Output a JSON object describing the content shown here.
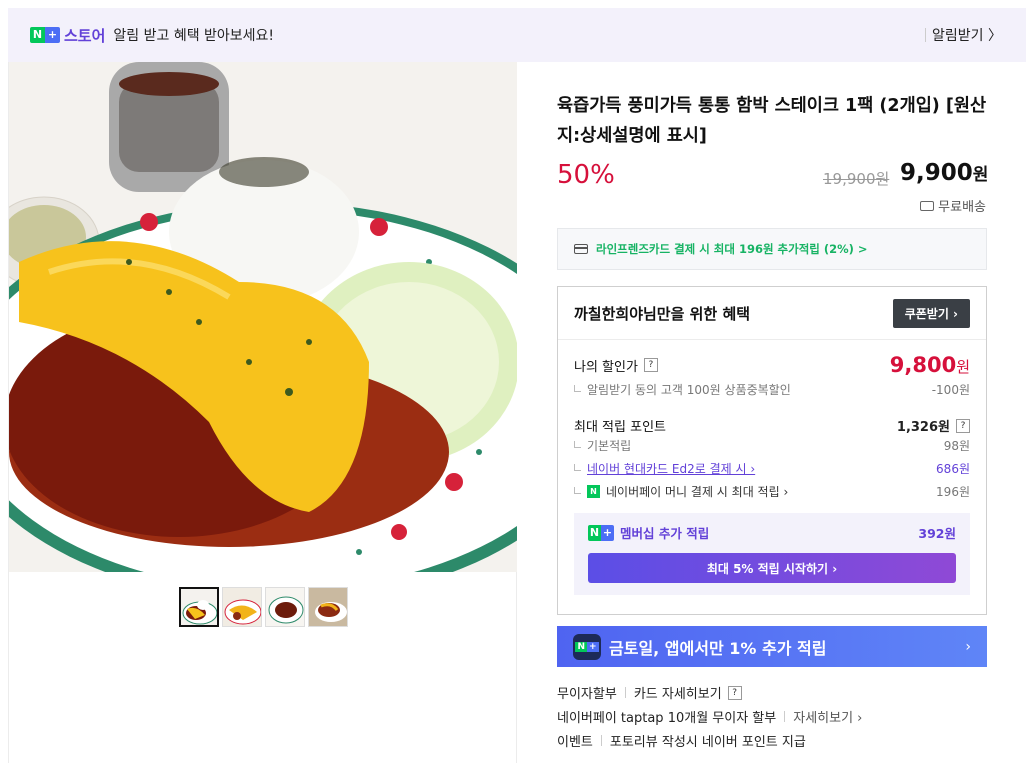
{
  "banner": {
    "badge_n": "N",
    "badge_plus": "+",
    "store_label": "스토어",
    "message": "알림 받고 혜택 받아보세요!",
    "alarm_label": "알림받기 〉"
  },
  "product": {
    "title": "육즙가득 풍미가득 통통 함박 스테이크 1팩 (2개입) [원산지:상세설명에 표시]",
    "discount_rate": "50%",
    "original_price": "19,900원",
    "sale_price_number": "9,900",
    "sale_price_unit": "원",
    "shipping": "무료배송"
  },
  "card_offer": {
    "text": "라인프렌즈카드 결제 시 최대 196원 추가적립 (2%) >"
  },
  "benefits": {
    "header": "까칠한희야님만을 위한 혜택",
    "coupon_button": "쿠폰받기 ›",
    "my_price_label": "나의 할인가",
    "my_price_number": "9,800",
    "my_price_unit": "원",
    "alarm_discount_label": "알림받기 동의 고객 100원 상품중복할인",
    "alarm_discount_value": "-100원",
    "max_points_label": "최대 적립 포인트",
    "max_points_value": "1,326원",
    "basic_label": "기본적립",
    "basic_value": "98원",
    "hyundai_label": "네이버 현대카드 Ed2로 결제 시 ›",
    "hyundai_value": "686원",
    "npay_money_label": "네이버페이 머니 결제 시 최대 적립 ›",
    "npay_money_value": "196원",
    "member_label": "멤버십 추가 적립",
    "member_value": "392원",
    "member_cta": "최대 5% 적립 시작하기 ›"
  },
  "promo": {
    "text": "금토일, 앱에서만 1% 추가 적립",
    "arrow": "›"
  },
  "info_lines": {
    "installment_label": "무이자할부",
    "installment_detail": "카드 자세히보기",
    "taptap_text": "네이버페이 taptap 10개월 무이자 할부",
    "taptap_detail": "자세히보기 ›",
    "event_label": "이벤트",
    "event_text": "포토리뷰 작성시 네이버 포인트 지급"
  },
  "colors": {
    "accent_red": "#d6103b",
    "naver_green": "#03c75a",
    "purple": "#6241d8",
    "promo_blue": "#5f85f7"
  },
  "question_mark": "?"
}
